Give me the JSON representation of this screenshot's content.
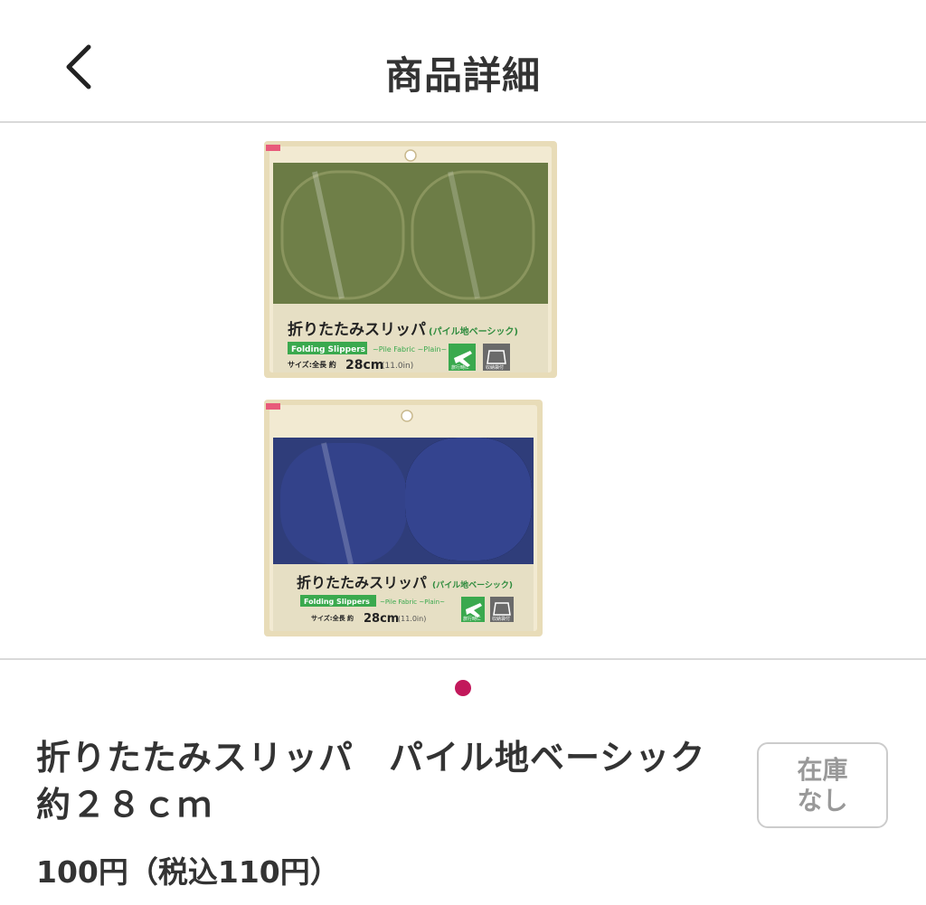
{
  "header": {
    "title": "商品詳細",
    "back_icon": "chevron-left-icon"
  },
  "gallery": {
    "image_count": 1,
    "active_index": 0,
    "active_dot_color": "#c2185b",
    "package_1": {
      "color": "green",
      "jp_title": "折りたたみスリッパ",
      "jp_subtitle": "(パイル地ベーシック)",
      "en_title": "Folding Slippers",
      "en_subtitle": "~Pile Fabric ~Plain~",
      "size_label": "サイズ:全長 約",
      "size_value": "28cm",
      "size_inch": "(11.0in)",
      "travel_label": "旅行時に",
      "storage_label": "収納袋付"
    },
    "package_2": {
      "color": "navy",
      "jp_title": "折りたたみスリッパ",
      "jp_subtitle": "(パイル地ベーシック)",
      "en_title": "Folding Slippers",
      "en_subtitle": "~Pile Fabric ~Plain~",
      "size_label": "サイズ:全長 約",
      "size_value": "28cm",
      "size_inch": "(11.0in)",
      "travel_label": "旅行時に",
      "storage_label": "収納袋付"
    }
  },
  "product": {
    "name_line1": "折りたたみスリッパ　パイル地ベーシック",
    "name_line2": "約２８ｃｍ",
    "price": "100円（税込110円）"
  },
  "stock": {
    "line1": "在庫",
    "line2": "なし"
  }
}
